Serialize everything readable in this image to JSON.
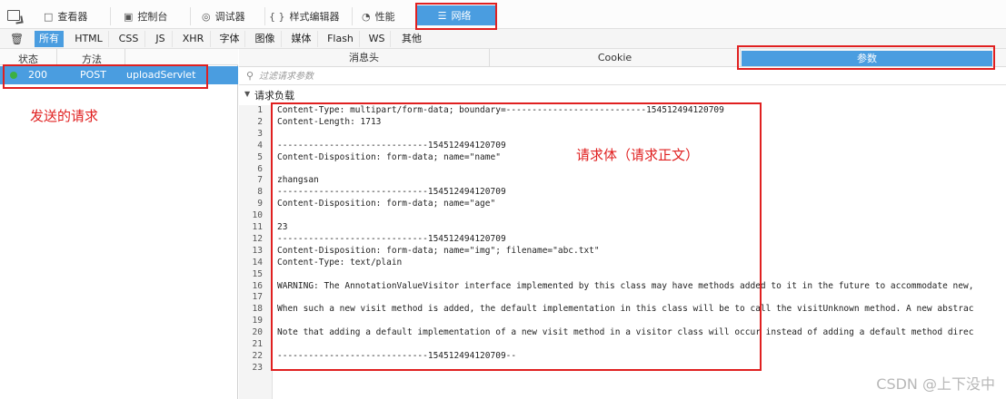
{
  "toolbar": {
    "tabs": [
      {
        "label": "查看器",
        "icon": "□"
      },
      {
        "label": "控制台",
        "icon": "▣"
      },
      {
        "label": "调试器",
        "icon": "◎"
      },
      {
        "label": "样式编辑器",
        "icon": "{ }"
      },
      {
        "label": "性能",
        "icon": "◔"
      },
      {
        "label": "网络",
        "icon": "☰"
      }
    ],
    "active_tab": "网络"
  },
  "filters": [
    "所有",
    "HTML",
    "CSS",
    "JS",
    "XHR",
    "字体",
    "图像",
    "媒体",
    "Flash",
    "WS",
    "其他"
  ],
  "request_list": {
    "col_status": "状态",
    "col_method": "方法",
    "rows": [
      {
        "status": "200",
        "method": "POST",
        "file": "uploadServlet",
        "status_color": "#3cb043"
      }
    ]
  },
  "details": {
    "tabs": [
      "消息头",
      "Cookie",
      "参数"
    ],
    "active_tab": "参数",
    "filter_placeholder": "过滤请求参数",
    "section_title": "请求负载",
    "lines": [
      "Content-Type: multipart/form-data; boundary=---------------------------154512494120709",
      "Content-Length: 1713",
      "",
      "-----------------------------154512494120709",
      "Content-Disposition: form-data; name=\"name\"",
      "",
      "zhangsan",
      "-----------------------------154512494120709",
      "Content-Disposition: form-data; name=\"age\"",
      "",
      "23",
      "-----------------------------154512494120709",
      "Content-Disposition: form-data; name=\"img\"; filename=\"abc.txt\"",
      "Content-Type: text/plain",
      "",
      "WARNING: The AnnotationValueVisitor interface implemented by this class may have methods added to it in the future to accommodate new,",
      "",
      "When such a new visit method is added, the default implementation in this class will be to call the visitUnknown method. A new abstrac",
      "",
      "Note that adding a default implementation of a new visit method in a visitor class will occur instead of adding a default method direc",
      "",
      "-----------------------------154512494120709--",
      ""
    ]
  },
  "annotations": {
    "sent_request": "发送的请求",
    "request_body": "请求体（请求正文）"
  },
  "watermark": "CSDN @上下没中",
  "colors": {
    "accent": "#4a9de0",
    "annotation": "#e02020"
  }
}
